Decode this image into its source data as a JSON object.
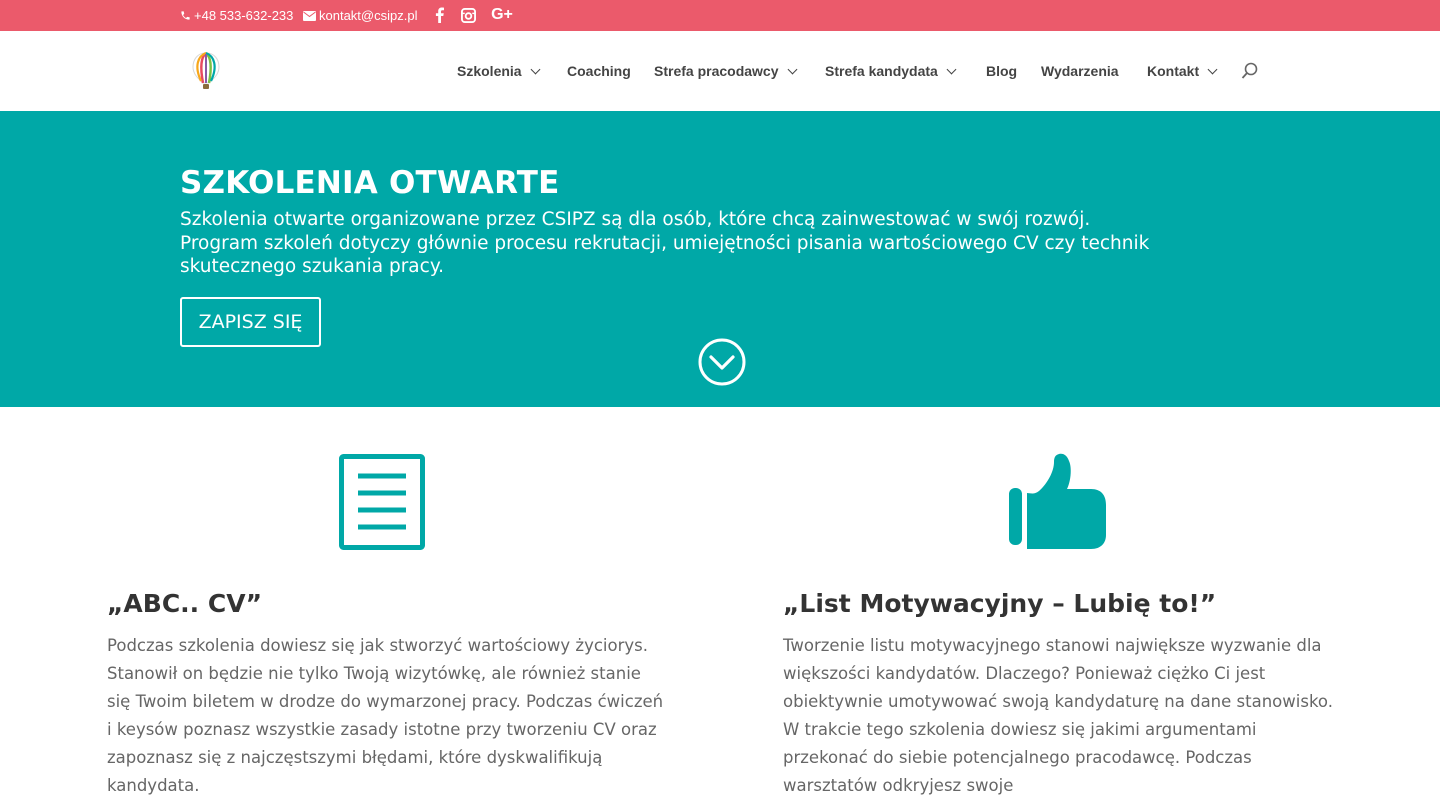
{
  "topbar": {
    "phone": "+48 533-632-233",
    "email": "kontakt@csipz.pl",
    "social_icons": [
      "facebook-icon",
      "instagram-icon",
      "google-plus-icon"
    ],
    "bg_color": "#eb5a6b"
  },
  "nav": {
    "items": [
      {
        "label": "Szkolenia",
        "has_dropdown": true,
        "active": true
      },
      {
        "label": "Coaching",
        "has_dropdown": false,
        "active": false
      },
      {
        "label": "Strefa pracodawcy",
        "has_dropdown": true,
        "active": false
      },
      {
        "label": "Strefa kandydata",
        "has_dropdown": true,
        "active": true
      },
      {
        "label": "Blog",
        "has_dropdown": false,
        "active": false
      },
      {
        "label": "Wydarzenia",
        "has_dropdown": false,
        "active": false
      },
      {
        "label": "Kontakt",
        "has_dropdown": true,
        "active": false
      }
    ],
    "accent_color": "#eb5a6b"
  },
  "hero": {
    "title": "SZKOLENIA OTWARTE",
    "description": "Szkolenia otwarte organizowane przez CSIPZ są dla osób, które chcą zainwestować w swój rozwój. Program szkoleń dotyczy głównie procesu rekrutacji, umiejętności pisania wartościowego CV czy technik skutecznego szukania pracy.",
    "button_label": "ZAPISZ SIĘ",
    "bg_color": "#00a8a7"
  },
  "columns": [
    {
      "icon": "document-icon",
      "title": "„ABC.. CV”",
      "text": "Podczas szkolenia dowiesz się jak stworzyć wartościowy życiorys. Stanowił on będzie nie tylko Twoją wizytówkę, ale również stanie się Twoim biletem w drodze do wymarzonej pracy. Podczas ćwiczeń i keysów poznasz wszystkie zasady istotne przy tworzeniu CV oraz zapoznasz się z najczęstszymi błędami, które dyskwalifikują kandydata."
    },
    {
      "icon": "thumbs-up-icon",
      "title": "„List Motywacyjny – Lubię to!”",
      "text": "Tworzenie listu motywacyjnego stanowi największe wyzwanie dla większości kandydatów. Dlaczego? Ponieważ ciężko Ci jest obiektywnie umotywować swoją kandydaturę na dane stanowisko. W trakcie tego szkolenia dowiesz się jakimi argumentami przekonać do siebie potencjalnego pracodawcę. Podczas warsztatów odkryjesz swoje"
    }
  ]
}
